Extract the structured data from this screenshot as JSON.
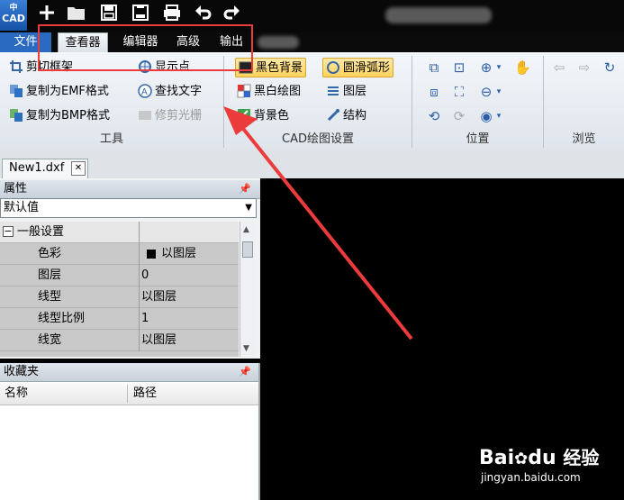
{
  "app": {
    "logo_text": "CAD"
  },
  "quick_access": [
    "new-icon",
    "open-icon",
    "save-icon",
    "save-as-icon",
    "print-icon",
    "undo-icon",
    "redo-icon"
  ],
  "menu": {
    "tabs": [
      {
        "label": "文件"
      },
      {
        "label": "查看器"
      },
      {
        "label": "编辑器"
      },
      {
        "label": "高级"
      },
      {
        "label": "输出"
      }
    ]
  },
  "ribbon": {
    "tools": {
      "items": [
        "剪切框架",
        "复制为EMF格式",
        "复制为BMP格式",
        "显示点",
        "查找文字",
        "修剪光栅"
      ],
      "label": "工具"
    },
    "cad_settings": {
      "items": [
        "黑色背景",
        "圆滑弧形",
        "黑白绘图",
        "图层",
        "背景色",
        "结构"
      ],
      "label": "CAD绘图设置"
    },
    "position": {
      "label": "位置"
    },
    "browse": {
      "label": "浏览"
    }
  },
  "document": {
    "tab_label": "New1.dxf"
  },
  "properties": {
    "title": "属性",
    "combo_value": "默认值",
    "category": "一般设置",
    "rows": [
      {
        "name": "色彩",
        "value": "以图层"
      },
      {
        "name": "图层",
        "value": "0"
      },
      {
        "name": "线型",
        "value": "以图层"
      },
      {
        "name": "线型比例",
        "value": "1"
      },
      {
        "name": "线宽",
        "value": "以图层"
      }
    ]
  },
  "favorites": {
    "title": "收藏夹",
    "col_name": "名称",
    "col_path": "路径"
  },
  "watermark": {
    "brand": "Bai",
    "brand2": "du",
    "suffix": "经验",
    "url": "jingyan.baidu.com"
  },
  "colors": {
    "annotation": "#ec3b3b",
    "accent": "#2a6ac0",
    "canvas": "#000000"
  }
}
